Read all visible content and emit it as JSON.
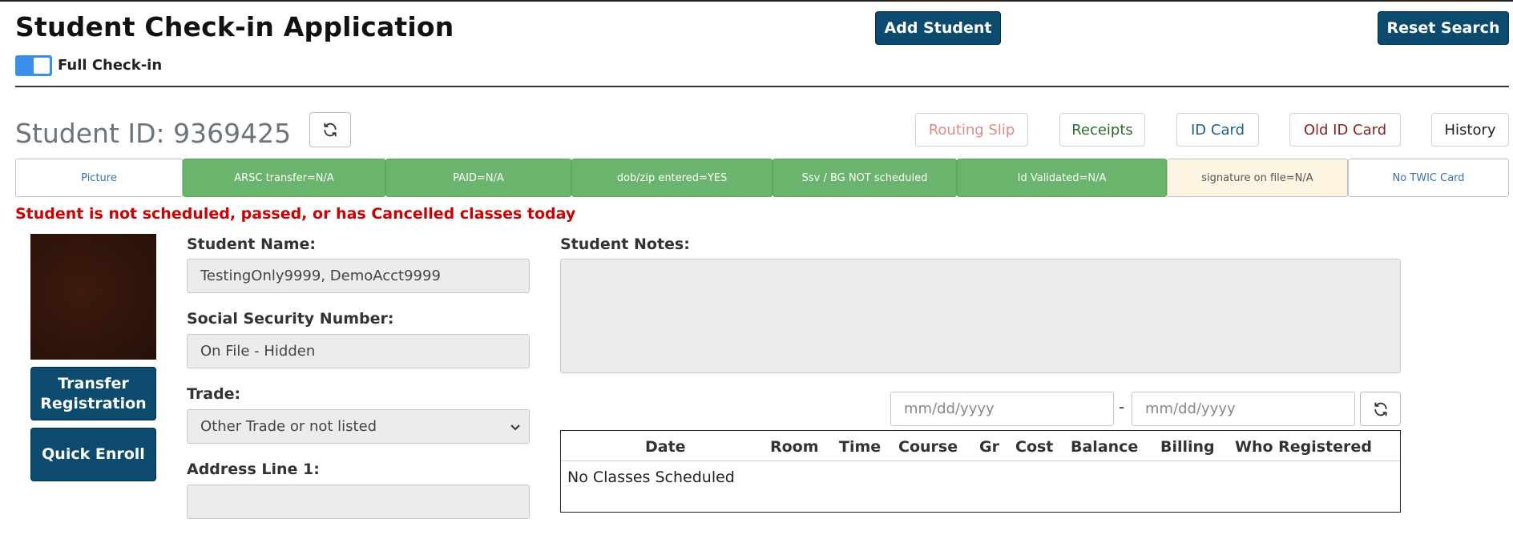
{
  "header": {
    "title": "Student Check-in Application",
    "add_student_label": "Add Student",
    "reset_search_label": "Reset Search",
    "full_checkin_label": "Full Check-in",
    "full_checkin_on": true
  },
  "student": {
    "id_label": "Student ID: 9369425",
    "actions": {
      "routing_slip": "Routing Slip",
      "receipts": "Receipts",
      "id_card": "ID Card",
      "old_id_card": "Old ID Card",
      "history": "History"
    }
  },
  "status_bar": [
    {
      "label": "Picture",
      "style": "white"
    },
    {
      "label": "ARSC transfer=N/A",
      "style": "green"
    },
    {
      "label": "PAID=N/A",
      "style": "green"
    },
    {
      "label": "dob/zip entered=YES",
      "style": "green"
    },
    {
      "label": "Ssv / BG NOT scheduled",
      "style": "green"
    },
    {
      "label": "Id Validated=N/A",
      "style": "green"
    },
    {
      "label": "signature on file=N/A",
      "style": "cream"
    },
    {
      "label": "No TWIC Card",
      "style": "white"
    }
  ],
  "warning": "Student is not scheduled, passed, or has Cancelled classes today",
  "side_buttons": {
    "transfer_registration": "Transfer Registration",
    "quick_enroll": "Quick Enroll"
  },
  "form": {
    "name_label": "Student Name:",
    "name_value": "TestingOnly9999, DemoAcct9999",
    "ssn_label": "Social Security Number:",
    "ssn_value": "On File - Hidden",
    "trade_label": "Trade:",
    "trade_value": "Other Trade or not listed",
    "address1_label": "Address Line 1:",
    "address1_value": ""
  },
  "notes": {
    "label": "Student Notes:",
    "value": ""
  },
  "date_filter": {
    "from_placeholder": "mm/dd/yyyy",
    "separator": "-",
    "to_placeholder": "mm/dd/yyyy"
  },
  "classes_table": {
    "columns": [
      "Date",
      "Room",
      "Time",
      "Course",
      "Gr",
      "Cost",
      "Balance",
      "Billing",
      "Who Registered"
    ],
    "empty_message": "No Classes Scheduled"
  },
  "colors": {
    "primary_button": "#0c4a6e",
    "status_green": "#6ab46d",
    "status_cream": "#fdf5e2",
    "warning_red": "#cc0000",
    "toggle_blue": "#3b8eea"
  }
}
